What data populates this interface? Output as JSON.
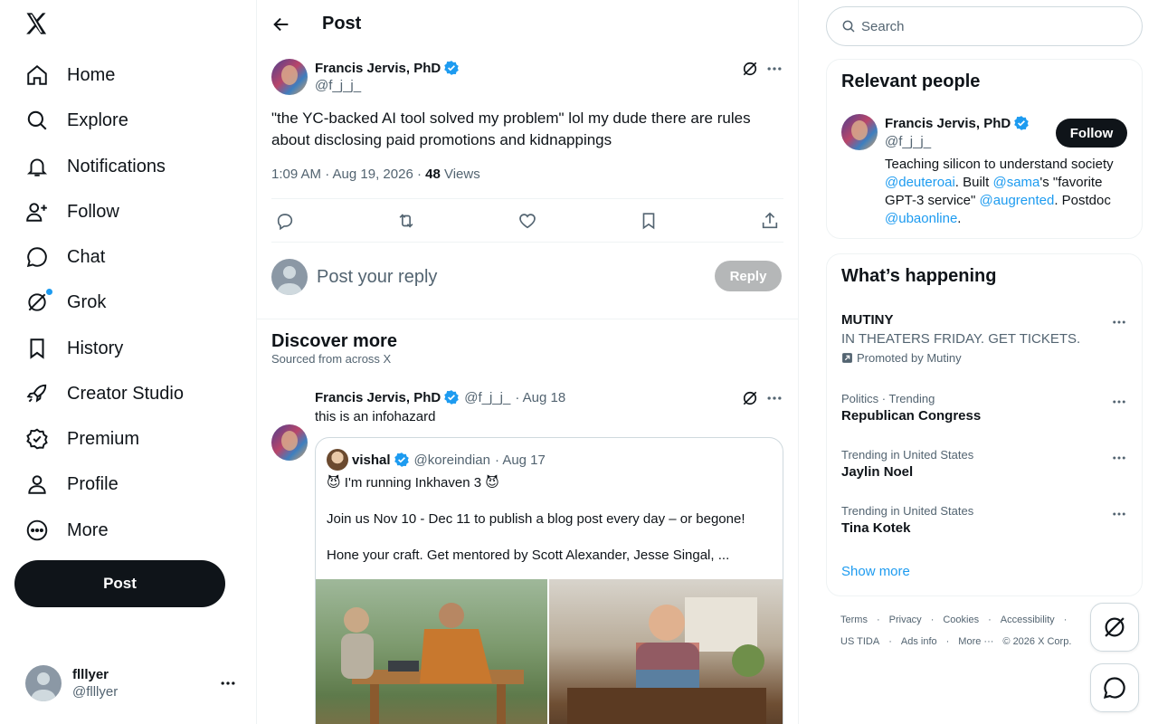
{
  "nav": {
    "items": [
      {
        "label": "Home",
        "icon": "home-icon"
      },
      {
        "label": "Explore",
        "icon": "search-icon"
      },
      {
        "label": "Notifications",
        "icon": "bell-icon"
      },
      {
        "label": "Follow",
        "icon": "person-add-icon"
      },
      {
        "label": "Chat",
        "icon": "chat-icon"
      },
      {
        "label": "Grok",
        "icon": "grok-icon"
      },
      {
        "label": "History",
        "icon": "bookmark-icon"
      },
      {
        "label": "Creator Studio",
        "icon": "rocket-icon"
      },
      {
        "label": "Premium",
        "icon": "verified-badge-icon"
      },
      {
        "label": "Profile",
        "icon": "person-icon"
      },
      {
        "label": "More",
        "icon": "more-circle-icon"
      }
    ],
    "post_button": "Post",
    "account": {
      "name": "flllyer",
      "handle": "@flllyer"
    }
  },
  "header": {
    "title": "Post"
  },
  "tweet": {
    "author": "Francis Jervis, PhD",
    "handle": "@f_j_j_",
    "text": "\"the YC-backed AI tool solved my problem\" lol my dude there are rules about disclosing paid promotions and kidnappings",
    "time": "1:09 AM · Aug 19, 2026 · ",
    "views": "48",
    "views_label": " Views"
  },
  "reply": {
    "placeholder": "Post your reply",
    "button": "Reply"
  },
  "discover": {
    "title": "Discover more",
    "subtitle": "Sourced from across X",
    "post": {
      "author": "Francis Jervis, PhD",
      "handle": "@f_j_j_",
      "date": "· Aug 18",
      "text": "this is an infohazard",
      "quote": {
        "author": "vishal",
        "handle": "@koreindian",
        "date": "· Aug 17",
        "line1": "😈 I'm running Inkhaven 3 😈",
        "line2": "Join us Nov 10 - Dec 11 to publish a blog post every day – or begone!",
        "line3": "Hone your craft. Get mentored by Scott Alexander, Jesse Singal, ..."
      }
    }
  },
  "sidebar": {
    "search_placeholder": "Search",
    "relevant": {
      "title": "Relevant people",
      "name": "Francis Jervis, PhD",
      "handle": "@f_j_j_",
      "follow": "Follow",
      "bio_1": "Teaching silicon to understand society ",
      "bio_link1": "@deuteroai",
      "bio_2": ". Built ",
      "bio_link2": "@sama",
      "bio_3": "'s \"favorite GPT-3 service\" ",
      "bio_link3": "@augrented",
      "bio_4": ". Postdoc ",
      "bio_link4": "@ubaonline",
      "bio_5": "."
    },
    "happening": {
      "title": "What’s happening",
      "promo": {
        "name": "MUTINY",
        "tagline": "IN THEATERS FRIDAY. GET TICKETS.",
        "promoted": "Promoted by Mutiny"
      },
      "trends": [
        {
          "context": "Politics · Trending",
          "name": "Republican Congress"
        },
        {
          "context": "Trending in United States",
          "name": "Jaylin Noel"
        },
        {
          "context": "Trending in United States",
          "name": "Tina Kotek"
        }
      ],
      "show_more": "Show more"
    },
    "footer": {
      "row1": [
        "Terms",
        "·",
        "Privacy",
        "·",
        "Cookies",
        "·",
        "Accessibility",
        "·"
      ],
      "row2": [
        "US TIDA",
        "·",
        "Ads info",
        "·",
        "More ···",
        "© 2026 X Corp."
      ]
    }
  }
}
